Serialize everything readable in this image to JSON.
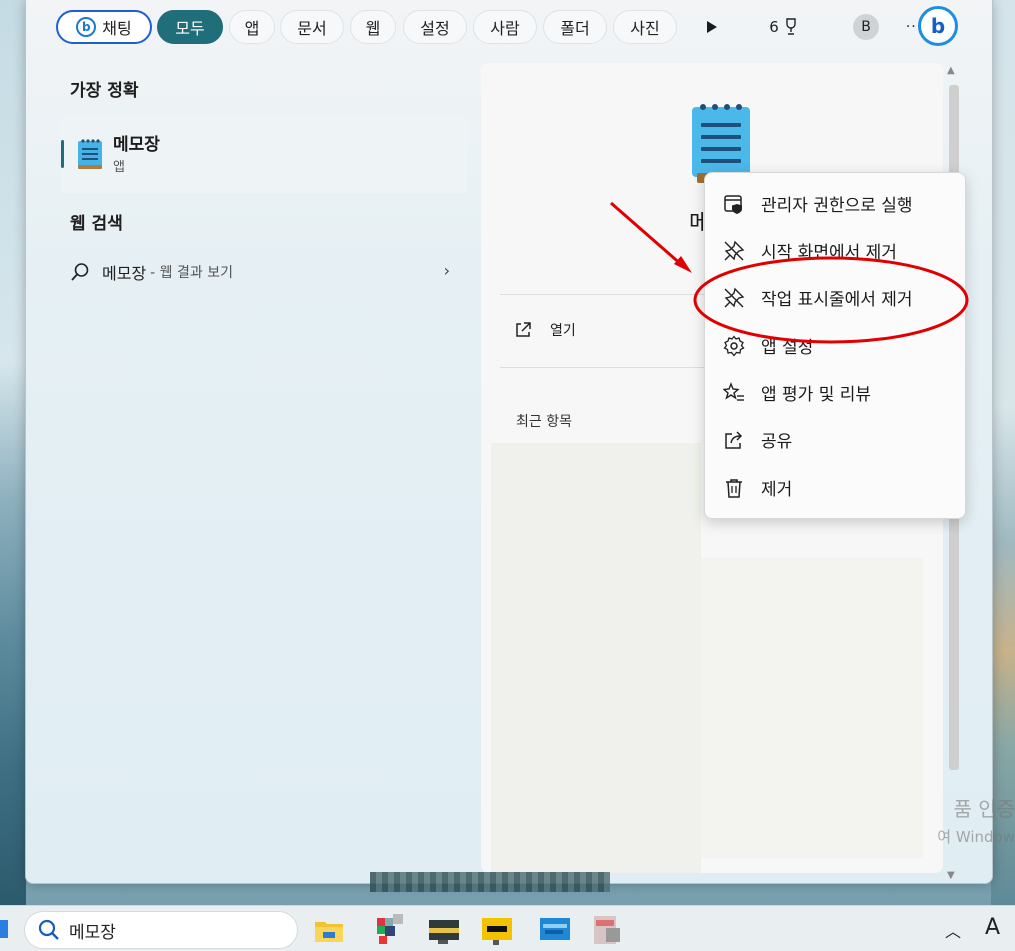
{
  "search_tabs": {
    "chat": "채팅",
    "all": "모두",
    "apps": "앱",
    "documents": "문서",
    "web": "웹",
    "settings": "설정",
    "people": "사람",
    "folders": "폴더",
    "photos": "사진",
    "rewards_count": "6",
    "avatar_letter": "B",
    "more": "···"
  },
  "best_match": {
    "heading": "가장 정확",
    "app_name": "메모장",
    "app_type": "앱"
  },
  "web_search": {
    "heading": "웹 검색",
    "query": "메모장",
    "suffix": "- 웹 결과 보기"
  },
  "detail": {
    "app_name_partial": "메",
    "open_label": "열기",
    "recent_label": "최근 항목"
  },
  "context_menu": {
    "items": [
      {
        "label": "관리자 권한으로 실행",
        "icon": "admin-shield-icon"
      },
      {
        "label": "시작 화면에서 제거",
        "icon": "unpin-icon"
      },
      {
        "label": "작업 표시줄에서 제거",
        "icon": "unpin-icon"
      },
      {
        "label": "앱 설정",
        "icon": "gear-icon"
      },
      {
        "label": "앱 평가 및 리뷰",
        "icon": "star-list-icon"
      },
      {
        "label": "공유",
        "icon": "share-icon"
      },
      {
        "label": "제거",
        "icon": "trash-icon"
      }
    ]
  },
  "taskbar": {
    "search_value": "메모장",
    "ime_indicator": "A"
  },
  "watermark": {
    "line1": "품 인증",
    "line2": "여 Window"
  },
  "colors": {
    "accent": "#1f6e79",
    "annotation": "#e00000",
    "bing_blue": "#1b79d1"
  }
}
